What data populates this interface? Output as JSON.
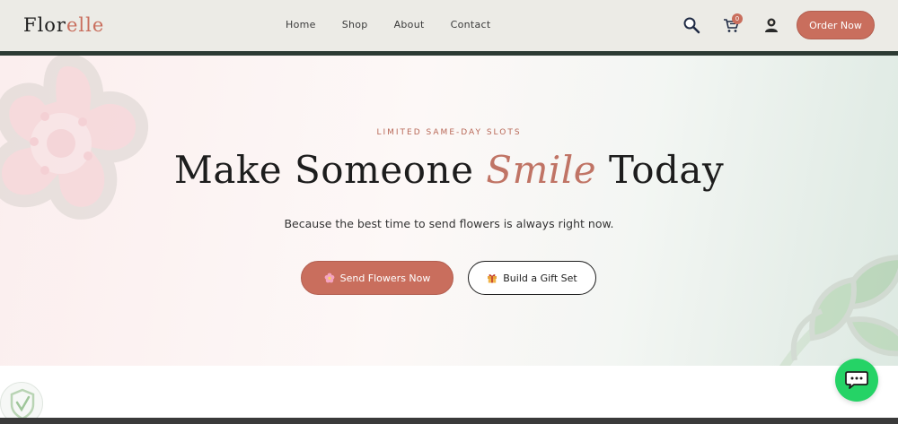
{
  "brand": {
    "name_main": "Flor",
    "name_accent": "elle"
  },
  "nav": {
    "items": [
      "Home",
      "Shop",
      "About",
      "Contact"
    ]
  },
  "header": {
    "cart_count": "0",
    "order_label": "Order Now"
  },
  "hero": {
    "eyebrow": "LIMITED SAME-DAY SLOTS",
    "headline_start": "Make Someone ",
    "headline_accent": "Smile",
    "headline_end": " Today",
    "subtitle": "Because the best time to send flowers is always right now.",
    "primary_label": "Send Flowers Now",
    "secondary_label": "Build a Gift Set"
  },
  "colors": {
    "accent": "#c96e5d",
    "header_bg": "#ecebe6",
    "header_rule": "#2c3a33",
    "chat": "#25d366"
  },
  "icons": [
    "search-icon",
    "cart-icon",
    "user-icon",
    "flower-icon",
    "gift-icon",
    "chat-icon"
  ]
}
